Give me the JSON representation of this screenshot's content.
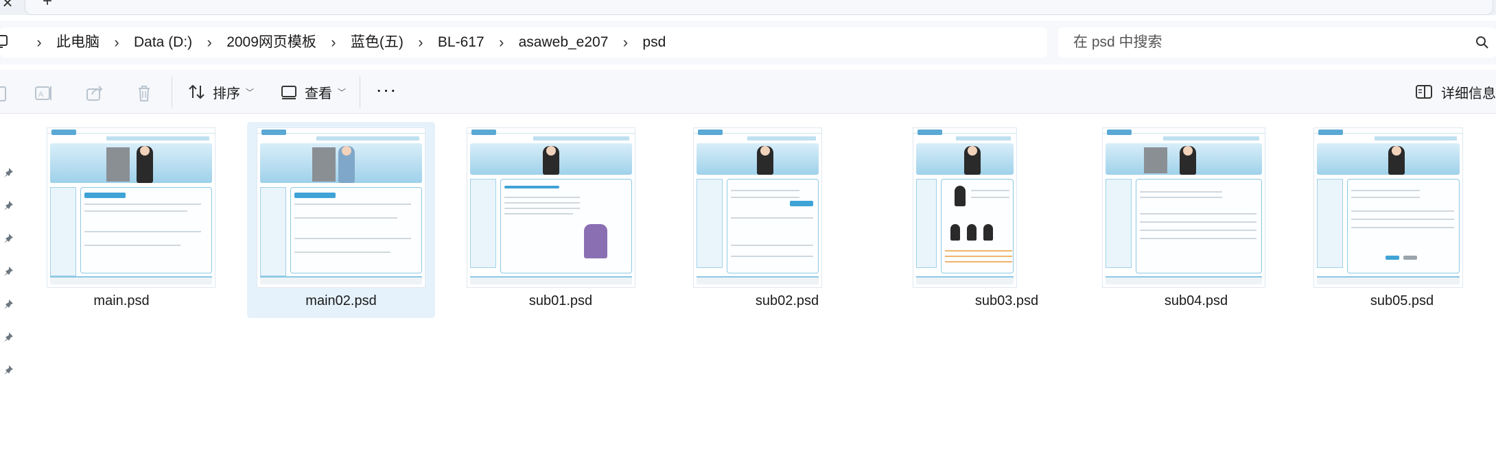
{
  "tabs": {
    "close_glyph": "✕",
    "new_tab_glyph": "+"
  },
  "breadcrumb": {
    "items": [
      {
        "label": "此电脑"
      },
      {
        "label": "Data (D:)"
      },
      {
        "label": "2009网页模板"
      },
      {
        "label": "蓝色(五)"
      },
      {
        "label": "BL-617"
      },
      {
        "label": "asaweb_e207"
      },
      {
        "label": "psd"
      }
    ],
    "separator": "›"
  },
  "search": {
    "placeholder": "在 psd 中搜索"
  },
  "toolbar": {
    "sort_label": "排序",
    "view_label": "查看",
    "more_label": "···",
    "details_label": "详细信息"
  },
  "files": [
    {
      "name": "main.psd",
      "selected": false
    },
    {
      "name": "main02.psd",
      "selected": true
    },
    {
      "name": "sub01.psd",
      "selected": false
    },
    {
      "name": "sub02.psd",
      "selected": false
    },
    {
      "name": "sub03.psd",
      "selected": false
    },
    {
      "name": "sub04.psd",
      "selected": false
    },
    {
      "name": "sub05.psd",
      "selected": false
    }
  ],
  "colors": {
    "accent": "#3fa3d6",
    "selection": "#e6f2fb",
    "chrome": "#f6f8fb"
  }
}
